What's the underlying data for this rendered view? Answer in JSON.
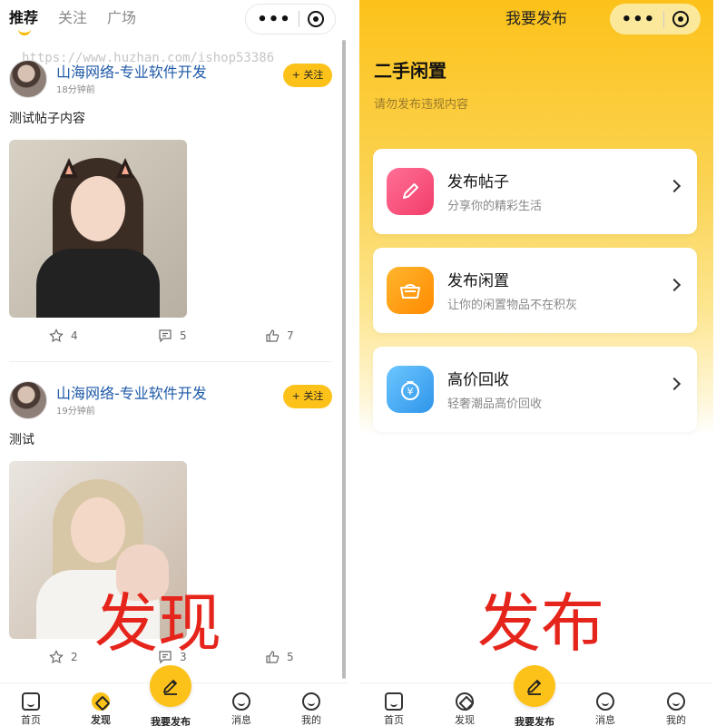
{
  "left": {
    "tabs": [
      "推荐",
      "关注",
      "广场"
    ],
    "watermark": "https://www.huzhan.com/ishop53386",
    "posts": [
      {
        "author": "山海网络-专业软件开发",
        "time": "18分钟前",
        "follow": "+ 关注",
        "text": "测试帖子内容",
        "stars": "4",
        "comments": "5",
        "likes": "7"
      },
      {
        "author": "山海网络-专业软件开发",
        "time": "19分钟前",
        "follow": "+ 关注",
        "text": "测试",
        "stars": "2",
        "comments": "3",
        "likes": "5"
      }
    ],
    "overlay_label": "发现",
    "tabbar": {
      "home": "首页",
      "discover": "发现",
      "publish": "我要发布",
      "messages": "消息",
      "mine": "我的"
    }
  },
  "right": {
    "title": "我要发布",
    "heading": "二手闲置",
    "subheading": "请勿发布违规内容",
    "cards": [
      {
        "title": "发布帖子",
        "desc": "分享你的精彩生活",
        "icon": "pencil-icon",
        "color": "#f24e7a"
      },
      {
        "title": "发布闲置",
        "desc": "让你的闲置物品不在积灰",
        "icon": "basket-icon",
        "color": "#ff9f0a"
      },
      {
        "title": "高价回收",
        "desc": "轻奢潮品高价回收",
        "icon": "money-bag-icon",
        "color": "#38a8f0"
      }
    ],
    "overlay_label": "发布",
    "tabbar": {
      "home": "首页",
      "discover": "发现",
      "publish": "我要发布",
      "messages": "消息",
      "mine": "我的"
    }
  },
  "colors": {
    "accent": "#fcc21a",
    "author": "#1f5aa8",
    "overlay": "#e5251c"
  }
}
